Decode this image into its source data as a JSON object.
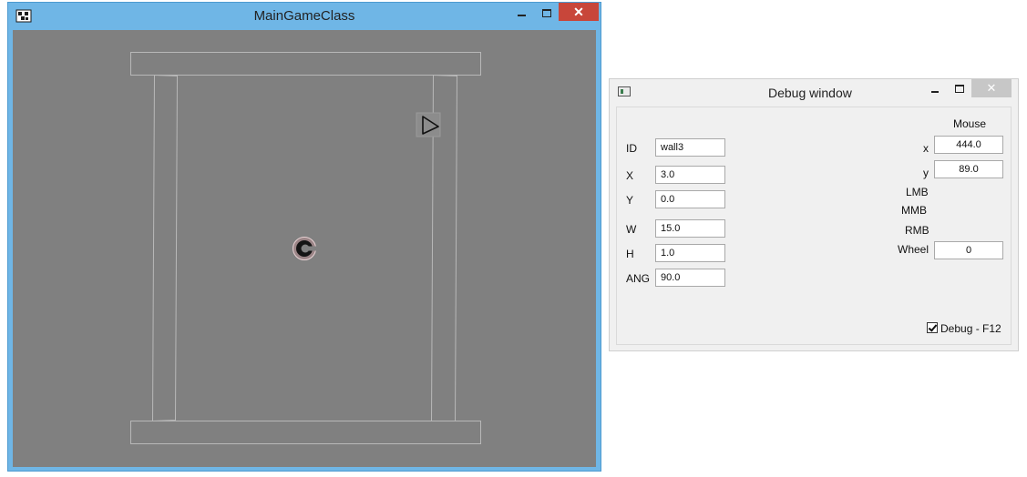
{
  "game_window": {
    "title": "MainGameClass",
    "close_label": "✕"
  },
  "debug_window": {
    "title": "Debug window",
    "close_label": "✕",
    "object": {
      "id_label": "ID",
      "id_value": "wall3",
      "x_label": "X",
      "x_value": "3.0",
      "y_label": "Y",
      "y_value": "0.0",
      "w_label": "W",
      "w_value": "15.0",
      "h_label": "H",
      "h_value": "1.0",
      "ang_label": "ANG",
      "ang_value": "90.0"
    },
    "mouse": {
      "heading": "Mouse",
      "x_label": "x",
      "x_value": "444.0",
      "y_label": "y",
      "y_value": "89.0",
      "lmb_label": "LMB",
      "mmb_label": "MMB",
      "rmb_label": "RMB",
      "wheel_label": "Wheel",
      "wheel_value": "0"
    },
    "debug_toggle": {
      "label": "Debug - F12",
      "checked": true
    }
  }
}
